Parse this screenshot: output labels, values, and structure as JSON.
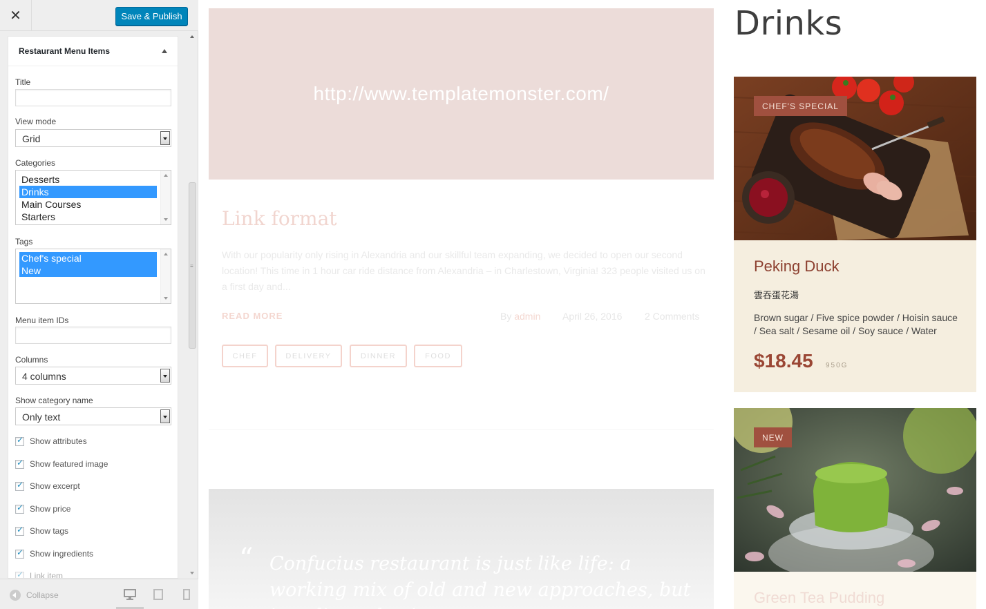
{
  "sidebar": {
    "save_label": "Save & Publish",
    "section_title": "Restaurant Menu Items",
    "title_label": "Title",
    "title_value": "",
    "view_mode_label": "View mode",
    "view_mode_value": "Grid",
    "categories_label": "Categories",
    "categories": [
      {
        "label": "Desserts",
        "selected": false
      },
      {
        "label": "Drinks",
        "selected": true
      },
      {
        "label": "Main Courses",
        "selected": false
      },
      {
        "label": "Starters",
        "selected": false
      }
    ],
    "tags_label": "Tags",
    "tags": [
      {
        "label": "Chef's special",
        "selected": true
      },
      {
        "label": "New",
        "selected": true
      }
    ],
    "menu_ids_label": "Menu item IDs",
    "menu_ids_value": "",
    "columns_label": "Columns",
    "columns_value": "4 columns",
    "show_category_label": "Show category name",
    "show_category_value": "Only text",
    "checkboxes": [
      {
        "label": "Show attributes",
        "checked": true
      },
      {
        "label": "Show featured image",
        "checked": true
      },
      {
        "label": "Show excerpt",
        "checked": true
      },
      {
        "label": "Show price",
        "checked": true
      },
      {
        "label": "Show tags",
        "checked": true
      },
      {
        "label": "Show ingredients",
        "checked": true
      },
      {
        "label": "Link item",
        "checked": true
      }
    ],
    "collapse_label": "Collapse"
  },
  "preview": {
    "link_url": "http://www.templatemonster.com/",
    "post_title": "Link format",
    "post_excerpt": "With our popularity only rising in Alexandria and our skillful team expanding, we decided to open our second location! This time in 1 hour car ride distance from Alexandria – in Charlestown, Virginia! 323 people visited us on a first day and...",
    "read_more": "READ MORE",
    "meta_by": "By",
    "meta_author": "admin",
    "meta_date": "April 26, 2016",
    "meta_comments": "2 Comments",
    "tags": [
      "CHEF",
      "DELIVERY",
      "DINNER",
      "FOOD"
    ],
    "quote": "Confucius restaurant is just like life: a working mix of old and new approaches, but in culinary business",
    "drinks_title": "Drinks",
    "items": [
      {
        "badge": "CHEF'S SPECIAL",
        "name": "Peking Duck",
        "subtitle": "雲吞蛋花湯",
        "ingredients": "Brown sugar / Five spice powder / Hoisin sauce / Sea salt / Sesame oil / Soy sauce / Water",
        "price": "$18.45",
        "weight": "950G"
      },
      {
        "badge": "NEW",
        "name": "Green Tea Pudding"
      }
    ]
  },
  "colors": {
    "accent": "#0085ba",
    "selection": "#3399ff",
    "badge": "#a0503f",
    "price": "#9a4634"
  }
}
